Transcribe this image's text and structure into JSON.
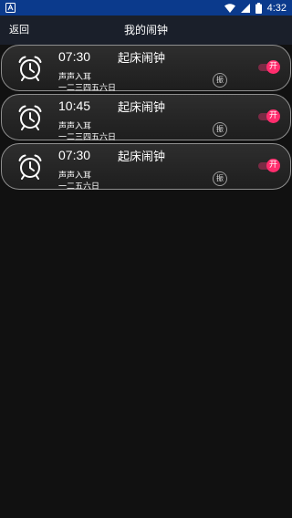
{
  "status_bar": {
    "time": "4:32",
    "color": "#0b3a8c"
  },
  "header": {
    "back_label": "返回",
    "title": "我的闹钟"
  },
  "alarms": [
    {
      "time": "07:30",
      "label": "起床闹钟",
      "sound": "声声入耳",
      "days": "一二三四五六日",
      "vibrate_label": "振",
      "toggle_label": "开",
      "enabled": true
    },
    {
      "time": "10:45",
      "label": "起床闹钟",
      "sound": "声声入耳",
      "days": "一二三四五六日",
      "vibrate_label": "振",
      "toggle_label": "开",
      "enabled": true
    },
    {
      "time": "07:30",
      "label": "起床闹钟",
      "sound": "声声入耳",
      "days": "一二五六日",
      "vibrate_label": "振",
      "toggle_label": "开",
      "enabled": true
    }
  ],
  "colors": {
    "toggle_on": "#ff2d6d",
    "background": "#111111",
    "card_border": "#8e8e8e"
  }
}
